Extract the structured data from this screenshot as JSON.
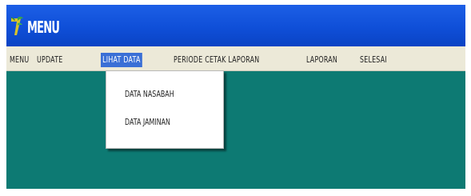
{
  "window": {
    "title": "MENU",
    "icon": "app-logo-icon",
    "title_bar_color": "#1452de",
    "desktop_color": "#0d7a73"
  },
  "menubar": {
    "items": [
      {
        "label": "MENU"
      },
      {
        "label": "UPDATE"
      },
      {
        "label": "LIHAT DATA",
        "selected": true
      },
      {
        "label": "PERIODE CETAK LAPORAN"
      },
      {
        "label": "LAPORAN"
      },
      {
        "label": "SELESAI"
      }
    ]
  },
  "dropdown": {
    "items": [
      {
        "label": "DATA NASABAH"
      },
      {
        "label": "DATA JAMINAN"
      }
    ]
  },
  "colors": {
    "menu_highlight": "#3a6fd6",
    "menubar_bg": "#ece9d8"
  }
}
